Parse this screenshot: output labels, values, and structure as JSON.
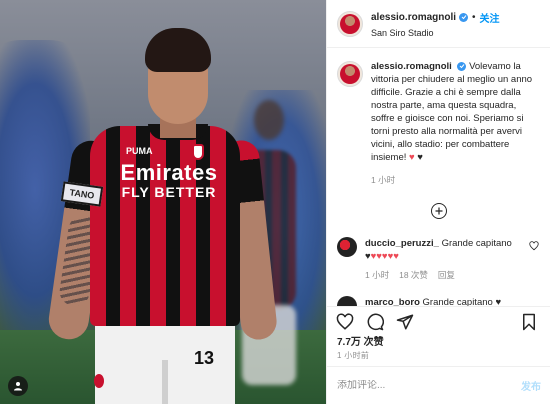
{
  "post": {
    "username": "alessio.romagnoli",
    "follow_label": "关注",
    "location": "San Siro Stadio",
    "more_icon": "ellipsis-icon"
  },
  "photo": {
    "armband_text": "TANO",
    "sponsor_line1": "Emirates",
    "sponsor_line2": "FLY BETTER",
    "kit_brand": "PUMA",
    "shorts_number": "13"
  },
  "caption": {
    "username": "alessio.romagnoli",
    "text": "Volevamo la vittoria per chiudere al meglio un anno difficile. Grazie a chi è sempre dalla nostra parte, ama questa squadra, soffre e gioisce con noi. Speriamo si torni presto alla normalità per avervi vicini, allo stadio: per combattere insieme!",
    "emoji_red": "♥",
    "emoji_black": "♥",
    "time": "1 小时"
  },
  "comments": [
    {
      "username": "duccio_peruzzi_",
      "text": "Grande capitano",
      "hearts": "♥♥♥♥♥",
      "time": "1 小时",
      "likes": "18 次赞",
      "reply": "回复"
    },
    {
      "username": "marco_boro",
      "text": "Grande capitano",
      "emoji": "♥"
    }
  ],
  "likes": "7.7万 次赞",
  "post_time": "1 小时前",
  "add_comment": {
    "placeholder": "添加评论...",
    "publish_label": "发布"
  },
  "colors": {
    "accent_blue": "#0095f6",
    "heart_red": "#ed4956",
    "muted_gray": "#8e8e8e"
  }
}
